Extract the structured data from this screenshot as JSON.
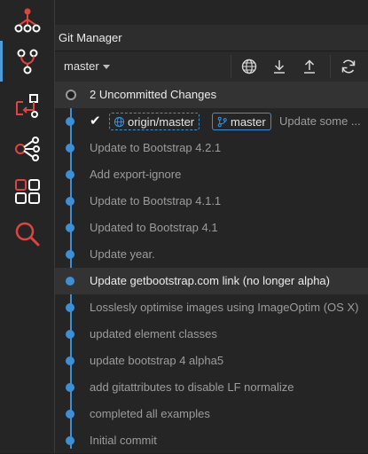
{
  "panel": {
    "title": "Git Manager"
  },
  "toolbar": {
    "branch": "master"
  },
  "uncommitted": {
    "label": "2 Uncommitted Changes"
  },
  "head": {
    "remote_tag": "origin/master",
    "local_tag": "master",
    "message": "Update some ..."
  },
  "commits": [
    {
      "message": "Update to Bootstrap 4.2.1"
    },
    {
      "message": "Add export-ignore"
    },
    {
      "message": "Update to Bootstrap 4.1.1"
    },
    {
      "message": "Updated to Bootstrap 4.1"
    },
    {
      "message": "Update year."
    },
    {
      "message": "Update getbootstrap.com link (no longer alpha)"
    },
    {
      "message": "Losslesly optimise images using ImageOptim (OS X)"
    },
    {
      "message": "updated element classes"
    },
    {
      "message": "update bootstrap 4 alpha5"
    },
    {
      "message": "add gitattributes to disable LF normalize"
    },
    {
      "message": "completed all examples"
    },
    {
      "message": "Initial commit"
    }
  ],
  "colors": {
    "accent": "#3d8fd6",
    "icon_red": "#e0443e",
    "icon_white": "#ffffff"
  }
}
